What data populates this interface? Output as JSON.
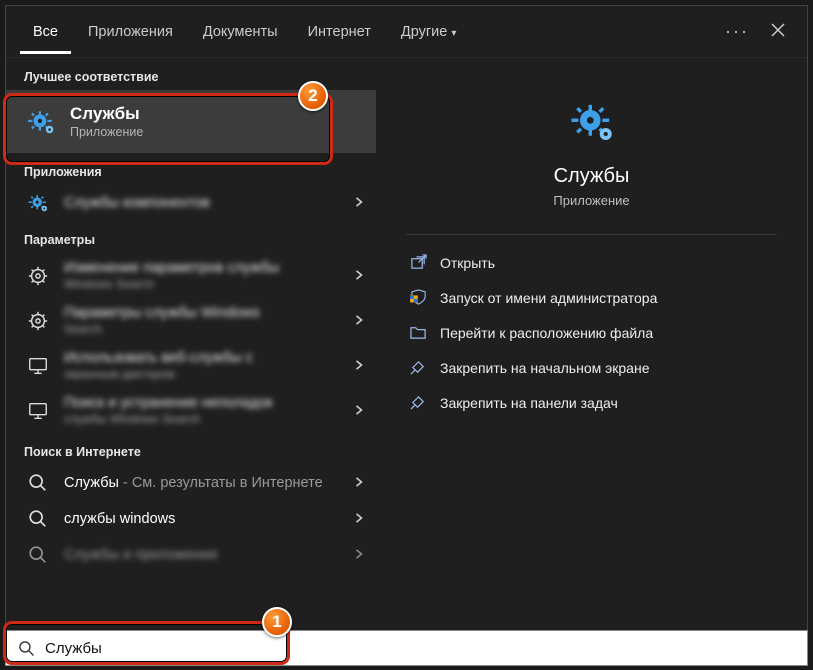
{
  "tabs": {
    "all": "Все",
    "apps": "Приложения",
    "docs": "Документы",
    "internet": "Интернет",
    "more": "Другие"
  },
  "sections": {
    "best_match": "Лучшее соответствие",
    "apps": "Приложения",
    "settings": "Параметры",
    "web": "Поиск в Интернете"
  },
  "best": {
    "title": "Службы",
    "sub": "Приложение"
  },
  "apps_results": [
    {
      "title": "Службы компонентов"
    }
  ],
  "settings_results": [
    {
      "title": "Изменение параметров службы",
      "sub": "Windows Search"
    },
    {
      "title": "Параметры службы Windows",
      "sub": "Search"
    },
    {
      "title": "Использовать веб-службы с",
      "sub": "экранным диктором"
    },
    {
      "title": "Поиск и устранение неполадок",
      "sub": "службы Windows Search"
    }
  ],
  "web_results": [
    {
      "title": "Службы",
      "suffix": " - См. результаты в Интернете"
    },
    {
      "title": "службы windows",
      "suffix": ""
    },
    {
      "title": "Службы и приложения",
      "suffix": ""
    }
  ],
  "preview": {
    "title": "Службы",
    "sub": "Приложение"
  },
  "actions": {
    "open": "Открыть",
    "run_admin": "Запуск от имени администратора",
    "file_loc": "Перейти к расположению файла",
    "pin_start": "Закрепить на начальном экране",
    "pin_taskbar": "Закрепить на панели задач"
  },
  "search_value": "Службы",
  "badges": {
    "b1": "1",
    "b2": "2"
  }
}
